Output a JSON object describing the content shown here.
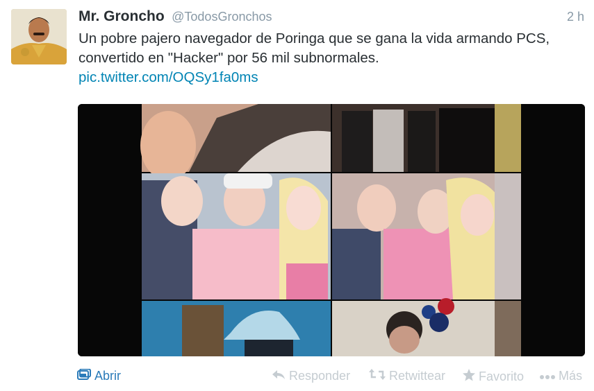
{
  "tweet": {
    "author_name": "Mr. Groncho",
    "author_handle": "@TodosGronchos",
    "time": "2 h",
    "text": "Un pobre pajero navegador de Poringa que se gana la vida armando PCS, convertido en \"Hacker\" por 56 mil subnormales.",
    "link": "pic.twitter.com/OQSy1fa0ms"
  },
  "actions": {
    "open": "Abrir",
    "reply": "Responder",
    "retweet": "Retwittear",
    "favorite": "Favorito",
    "more": "Más"
  },
  "icons": {
    "open": "media-card-icon",
    "reply": "reply-arrow-icon",
    "retweet": "retweet-icon",
    "favorite": "star-icon",
    "more": "dots-icon"
  },
  "colors": {
    "link": "#0084b4",
    "open_action": "#2b7bb9",
    "muted_action": "#c5ccd1",
    "secondary_text": "#8899a6"
  }
}
